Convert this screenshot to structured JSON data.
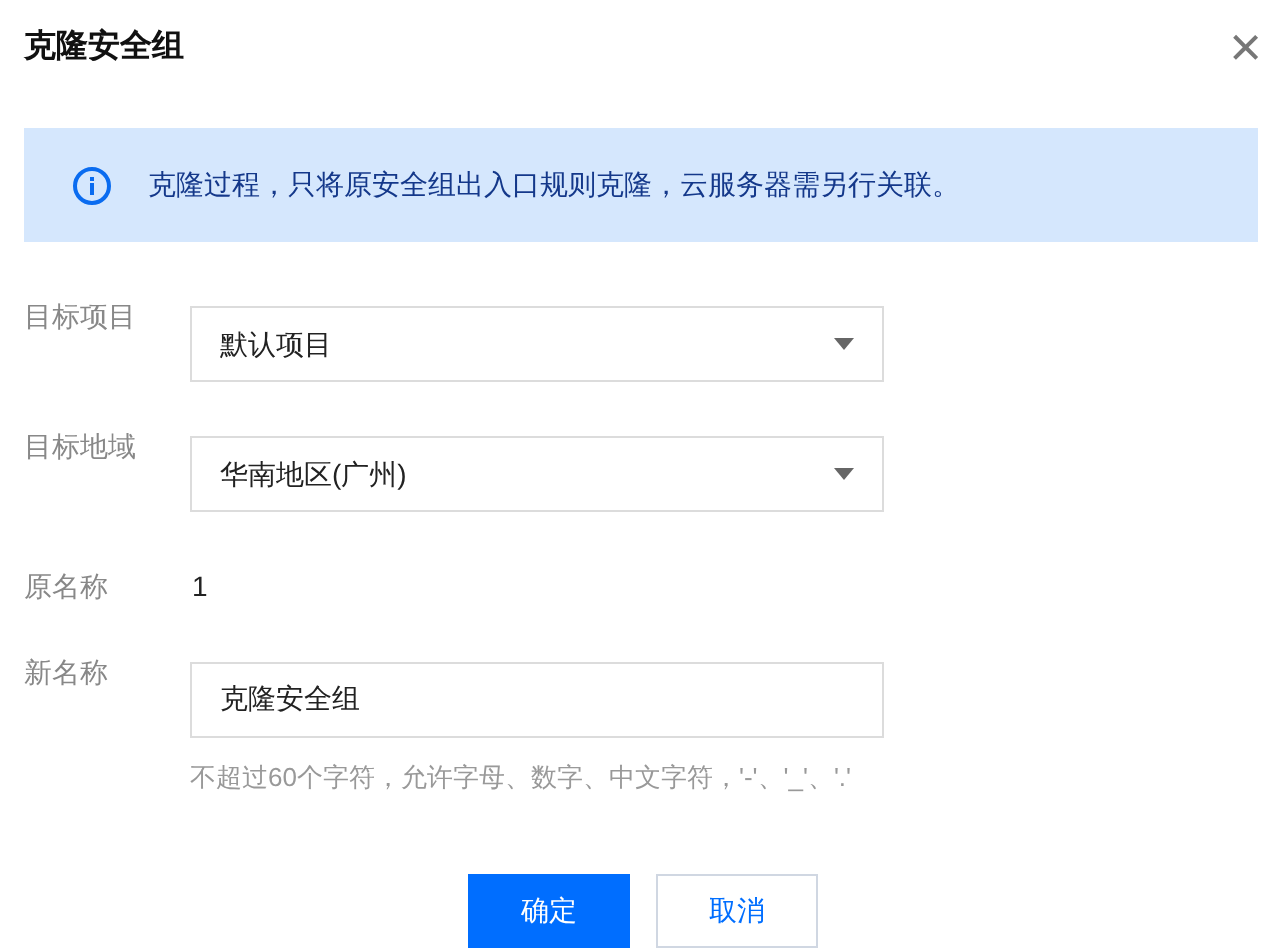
{
  "dialog": {
    "title": "克隆安全组",
    "close": "×"
  },
  "notice": "克隆过程，只将原安全组出入口规则克隆，云服务器需另行关联。",
  "fields": [
    {
      "kind": "select",
      "label": "目标项目",
      "value": "默认项目"
    },
    {
      "kind": "select",
      "label": "目标地域",
      "value": "华南地区(广州)"
    },
    {
      "kind": "text",
      "label": "原名称",
      "value": "1"
    },
    {
      "kind": "input",
      "label": "新名称",
      "value": "克隆安全组",
      "hint": "不超过60个字符，允许字母、数字、中文字符，'-'、'_'、'.'"
    }
  ],
  "buttons": [
    {
      "kind": "primary",
      "label": "确定"
    },
    {
      "kind": "secondary",
      "label": "取消"
    }
  ]
}
